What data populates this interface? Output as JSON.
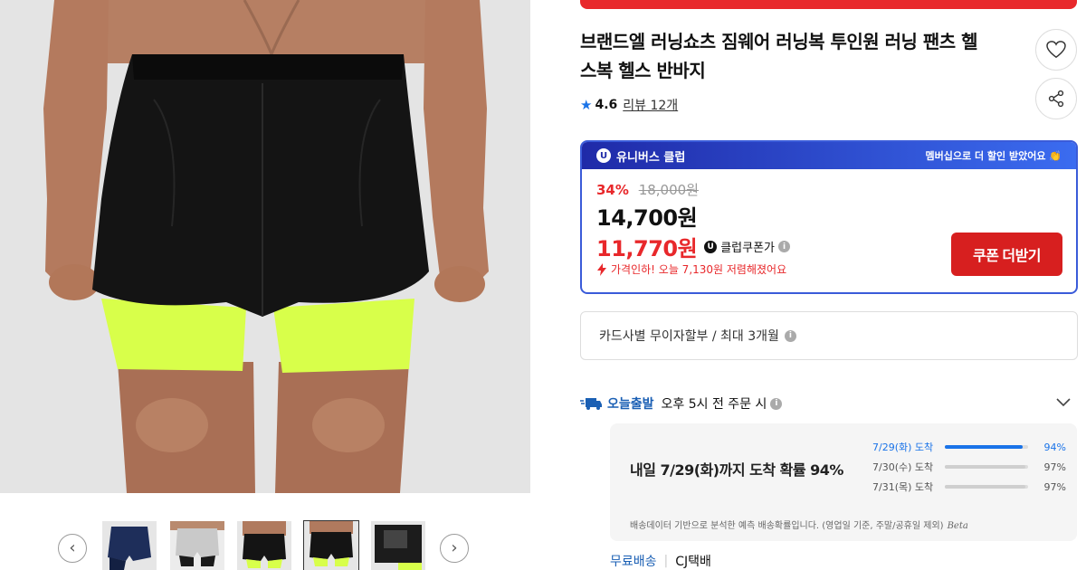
{
  "gallery": {
    "prev_label": "‹",
    "next_label": "›",
    "thumbnails": [
      {
        "name": "thumb-navy"
      },
      {
        "name": "thumb-gray"
      },
      {
        "name": "thumb-black-back"
      },
      {
        "name": "thumb-black-front",
        "selected": true
      },
      {
        "name": "thumb-black-pocket"
      }
    ]
  },
  "product": {
    "title_line1": "브랜드엘 러닝쇼츠 짐웨어 러닝복 투인원 러닝 팬츠 헬",
    "title_line2": "스복 헬스 반바지",
    "rating": "4.6",
    "reviews": "리뷰 12개",
    "wish_icon": "heart-icon",
    "share_icon": "share-icon"
  },
  "club": {
    "name": "유니버스 클럽",
    "badge": "U",
    "promo": "멤버십으로 더 할인 받았어요 👏",
    "discount_rate": "34%",
    "original_price": "18,000원",
    "sale_price": "14,700원",
    "coupon_price": "11,770원",
    "coupon_badge": "U",
    "coupon_label": "클럽쿠폰가",
    "price_drop": "가격인하! 오늘 7,130원 저렴해졌어요",
    "coupon_button": "쿠폰 더받기"
  },
  "card": {
    "text": "카드사별 무이자할부 / 최대 3개월"
  },
  "shipping": {
    "name": "오늘출발",
    "cutoff": "오후 5시 전 주문 시",
    "headline": "내일 7/29(화)까지 도착 확률 94%",
    "probabilities": [
      {
        "date": "7/29(화) 도착",
        "value": "94%",
        "fraction": 0.94,
        "active": true
      },
      {
        "date": "7/30(수) 도착",
        "value": "97%",
        "fraction": 0.97,
        "active": false
      },
      {
        "date": "7/31(목) 도착",
        "value": "97%",
        "fraction": 0.97,
        "active": false
      }
    ],
    "note": "배송데이터 기반으로 분석한 예측 배송확률입니다. (영업일 기준, 주말/공휴일 제외)",
    "beta": "Beta",
    "fee": "무료배송",
    "separator": "|",
    "courier": "CJ택배"
  },
  "info_glyph": "i",
  "colors": {
    "accent_red": "#e8282b",
    "club_blue": "#3a5bd9",
    "link_blue": "#1a73e8",
    "shorts_black": "#111111",
    "liner_lime": "#d8ff4a"
  }
}
